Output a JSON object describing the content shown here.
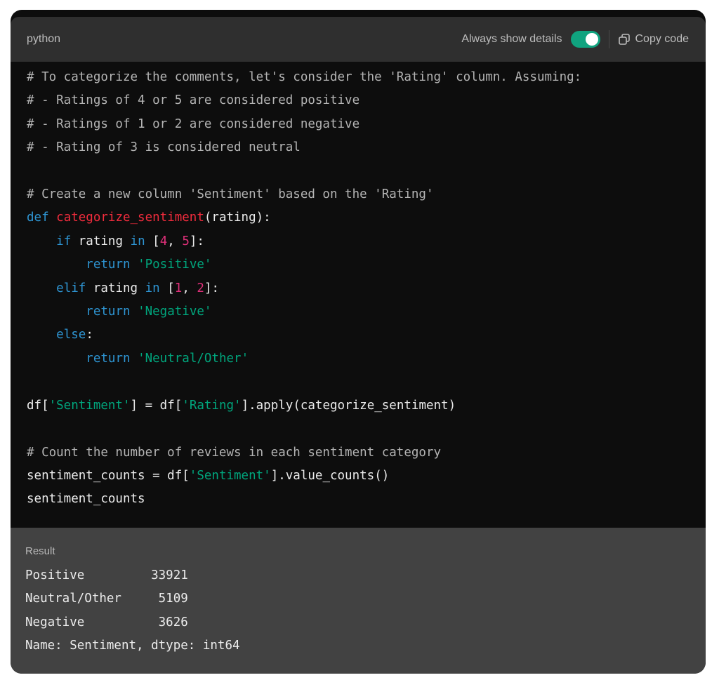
{
  "header": {
    "language": "python",
    "details_label": "Always show details",
    "details_on": true,
    "copy_label": "Copy code"
  },
  "code_lines": [
    [
      {
        "t": "# To categorize the comments, let's consider the 'Rating' column. Assuming:",
        "c": "comment"
      }
    ],
    [
      {
        "t": "# - Ratings of 4 or 5 are considered positive",
        "c": "comment"
      }
    ],
    [
      {
        "t": "# - Ratings of 1 or 2 are considered negative",
        "c": "comment"
      }
    ],
    [
      {
        "t": "# - Rating of 3 is considered neutral",
        "c": "comment"
      }
    ],
    [],
    [
      {
        "t": "# Create a new column 'Sentiment' based on the 'Rating'",
        "c": "comment"
      }
    ],
    [
      {
        "t": "def ",
        "c": "kw"
      },
      {
        "t": "categorize_sentiment",
        "c": "fn"
      },
      {
        "t": "(rating):",
        "c": "plain"
      }
    ],
    [
      {
        "t": "    ",
        "c": "plain"
      },
      {
        "t": "if",
        "c": "kw"
      },
      {
        "t": " rating ",
        "c": "plain"
      },
      {
        "t": "in",
        "c": "kw"
      },
      {
        "t": " [",
        "c": "plain"
      },
      {
        "t": "4",
        "c": "num"
      },
      {
        "t": ", ",
        "c": "plain"
      },
      {
        "t": "5",
        "c": "num"
      },
      {
        "t": "]:",
        "c": "plain"
      }
    ],
    [
      {
        "t": "        ",
        "c": "plain"
      },
      {
        "t": "return",
        "c": "kw"
      },
      {
        "t": " ",
        "c": "plain"
      },
      {
        "t": "'Positive'",
        "c": "str"
      }
    ],
    [
      {
        "t": "    ",
        "c": "plain"
      },
      {
        "t": "elif",
        "c": "kw"
      },
      {
        "t": " rating ",
        "c": "plain"
      },
      {
        "t": "in",
        "c": "kw"
      },
      {
        "t": " [",
        "c": "plain"
      },
      {
        "t": "1",
        "c": "num"
      },
      {
        "t": ", ",
        "c": "plain"
      },
      {
        "t": "2",
        "c": "num"
      },
      {
        "t": "]:",
        "c": "plain"
      }
    ],
    [
      {
        "t": "        ",
        "c": "plain"
      },
      {
        "t": "return",
        "c": "kw"
      },
      {
        "t": " ",
        "c": "plain"
      },
      {
        "t": "'Negative'",
        "c": "str"
      }
    ],
    [
      {
        "t": "    ",
        "c": "plain"
      },
      {
        "t": "else",
        "c": "kw"
      },
      {
        "t": ":",
        "c": "plain"
      }
    ],
    [
      {
        "t": "        ",
        "c": "plain"
      },
      {
        "t": "return",
        "c": "kw"
      },
      {
        "t": " ",
        "c": "plain"
      },
      {
        "t": "'Neutral/Other'",
        "c": "str"
      }
    ],
    [],
    [
      {
        "t": "df[",
        "c": "plain"
      },
      {
        "t": "'Sentiment'",
        "c": "str"
      },
      {
        "t": "] = df[",
        "c": "plain"
      },
      {
        "t": "'Rating'",
        "c": "str"
      },
      {
        "t": "].apply(categorize_sentiment)",
        "c": "plain"
      }
    ],
    [],
    [
      {
        "t": "# Count the number of reviews in each sentiment category",
        "c": "comment"
      }
    ],
    [
      {
        "t": "sentiment_counts = df[",
        "c": "plain"
      },
      {
        "t": "'Sentiment'",
        "c": "str"
      },
      {
        "t": "].value_counts()",
        "c": "plain"
      }
    ],
    [
      {
        "t": "sentiment_counts",
        "c": "plain"
      }
    ]
  ],
  "result": {
    "label": "Result",
    "lines": [
      "Positive         33921",
      "Neutral/Other     5109",
      "Negative          3626",
      "Name: Sentiment, dtype: int64"
    ]
  },
  "colors": {
    "toggle_on": "#10a37f",
    "keyword": "#2e95d3",
    "function": "#f22c3d",
    "string": "#00a67d",
    "number": "#df3079",
    "comment": "#b4b4b4"
  }
}
